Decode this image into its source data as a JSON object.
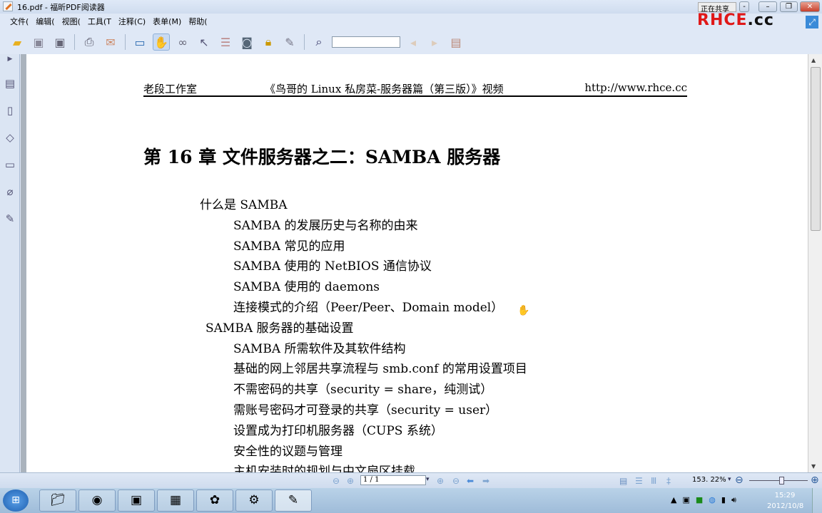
{
  "window": {
    "title": "16.pdf - 福昕PDF阅读器",
    "share_label": "正在共享",
    "minimize": "–",
    "restore": "❐",
    "close": "✕"
  },
  "logo": {
    "red": "RHCE",
    "black": ".cc"
  },
  "menu": [
    "文件(",
    "编辑(",
    "视图(",
    "工具(T",
    "注释(C)",
    "表单(M)",
    "帮助("
  ],
  "document": {
    "header": {
      "left": "老段工作室",
      "center": "《鸟哥的 Linux 私房菜-服务器篇（第三版）》视频",
      "right": "http://www.rhce.cc"
    },
    "chapter_title": "第 16 章  文件服务器之二：SAMBA  服务器",
    "toc": [
      {
        "text": "什么是  SAMBA",
        "level": 0
      },
      {
        "text": "SAMBA  的发展历史与名称的由来",
        "level": 1
      },
      {
        "text": "SAMBA  常见的应用",
        "level": 1
      },
      {
        "text": "SAMBA  使用的  NetBIOS  通信协议",
        "level": 1
      },
      {
        "text": "SAMBA  使用的  daemons",
        "level": 1
      },
      {
        "text": "连接模式的介绍（Peer/Peer、Domain model）",
        "level": 1
      },
      {
        "text": "SAMBA  服务器的基础设置",
        "level": 0
      },
      {
        "text": "SAMBA 所需软件及其软件结构",
        "level": 1
      },
      {
        "text": "基础的网上邻居共享流程与  smb.conf  的常用设置项目",
        "level": 1
      },
      {
        "text": "不需密码的共享（security = share，纯测试）",
        "level": 1
      },
      {
        "text": "需账号密码才可登录的共享（security = user）",
        "level": 1
      },
      {
        "text": "设置成为打印机服务器（CUPS  系统）",
        "level": 1
      },
      {
        "text": "安全性的议题与管理",
        "level": 1
      },
      {
        "text": "主机安装时的规划与中文扇区挂载",
        "level": 1
      }
    ]
  },
  "status": {
    "page": "1 / 1",
    "zoom": "153. 22%"
  },
  "clock": {
    "time": "15:29",
    "date": "2012/10/8"
  }
}
